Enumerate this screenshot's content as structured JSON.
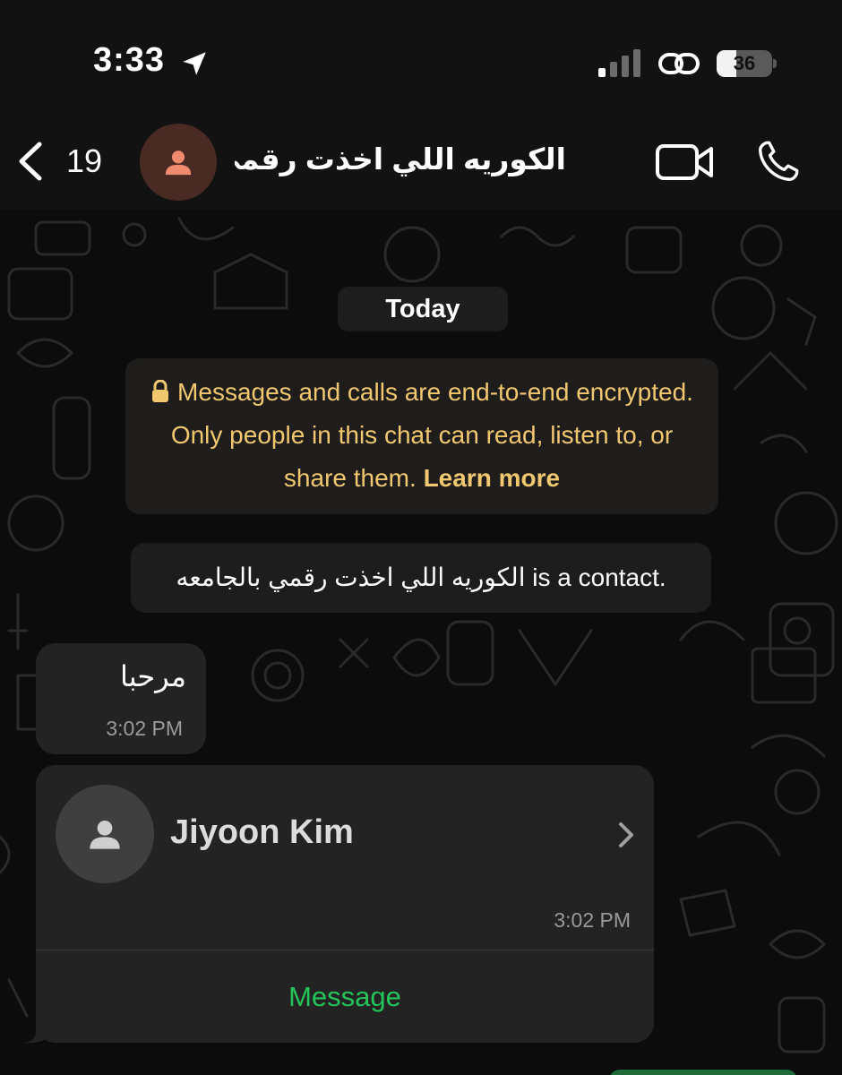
{
  "status_bar": {
    "time": "3:33",
    "battery": "36",
    "battery_level": 0.36
  },
  "header": {
    "back_count": "19",
    "contact_name": "الكوريه اللي اخذت رقمي...",
    "avatar_color": "#4a2b24",
    "avatar_icon_color": "#f08a6e"
  },
  "chat": {
    "date_label": "Today",
    "encryption_notice": {
      "text": "Messages and calls are end-to-end encrypted. Only people in this chat can read, listen to, or share them.",
      "link": "Learn more",
      "color": "#f1c770"
    },
    "contact_notice": "الكوريه اللي اخذت رقمي بالجامعه is a contact.",
    "messages": [
      {
        "text": "مرحبا",
        "time": "3:02 PM"
      }
    ],
    "contact_card": {
      "name": "Jiyoon Kim",
      "time": "3:02 PM",
      "action_label": "Message",
      "action_color": "#25c45a"
    }
  },
  "icons": {
    "location": "location-arrow-icon",
    "signal": "cellular-signal-icon",
    "link": "personal-hotspot-icon",
    "back": "chevron-left-icon",
    "video": "video-camera-icon",
    "call": "phone-icon",
    "lock": "lock-icon"
  }
}
